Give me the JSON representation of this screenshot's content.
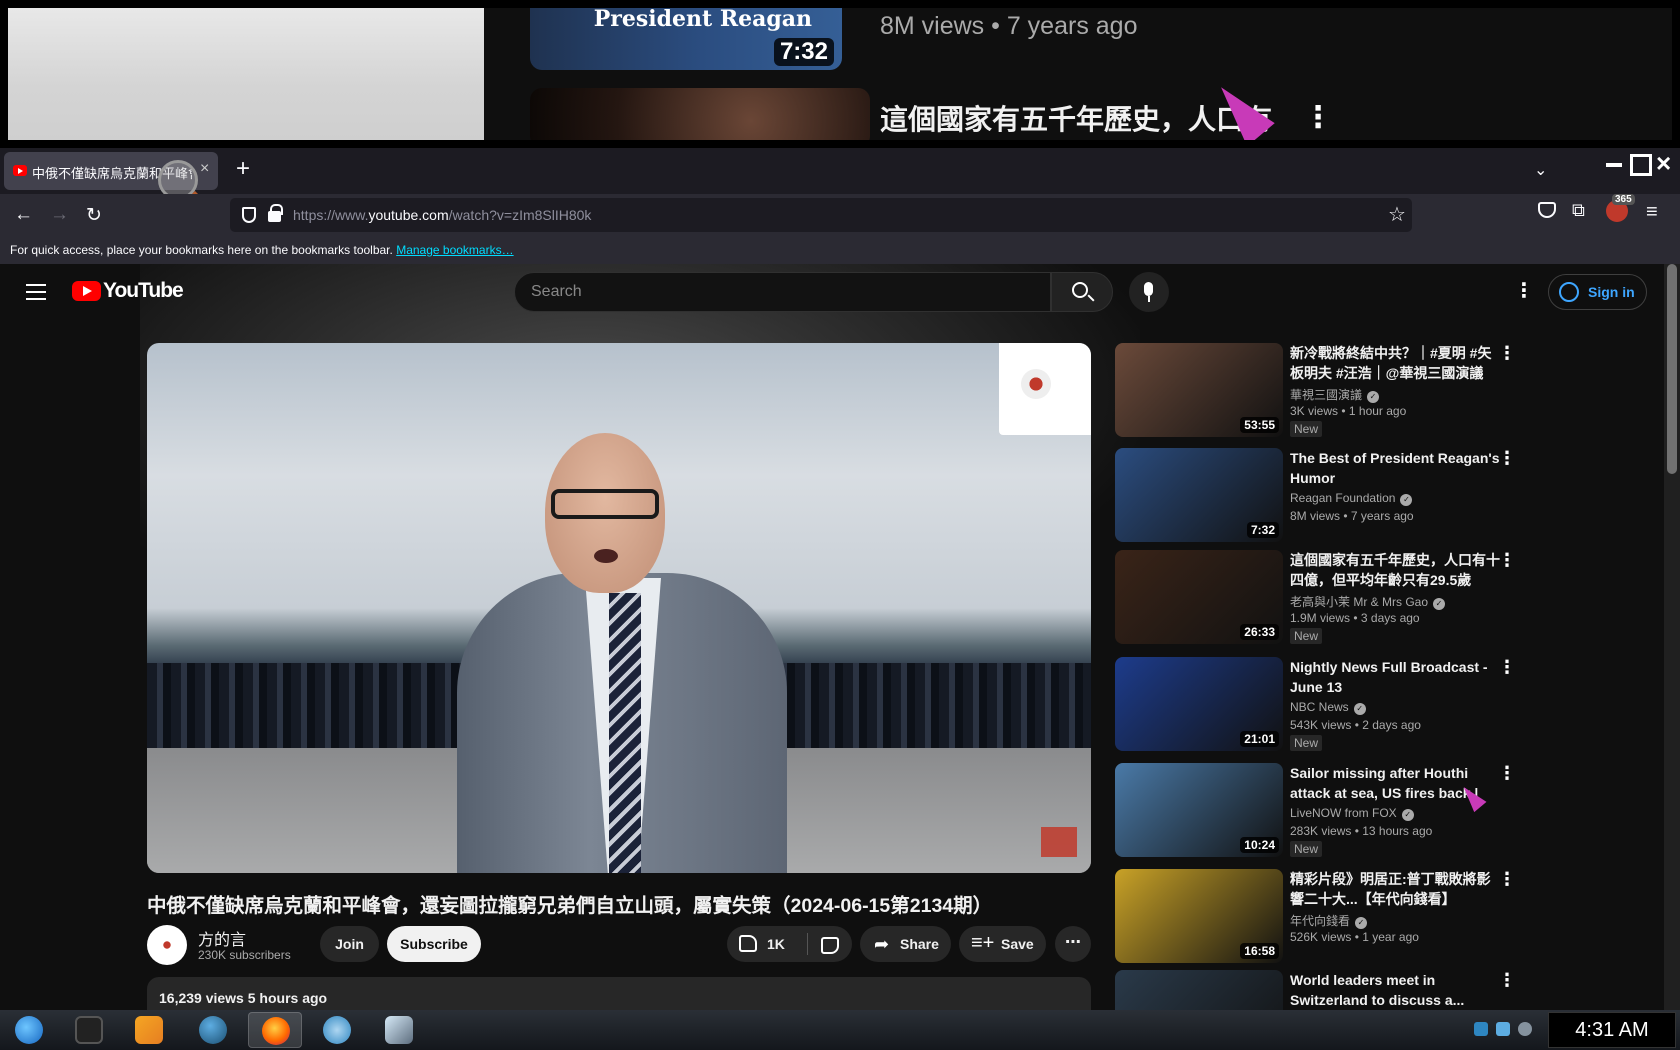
{
  "preview": {
    "thumb_title": "President Reagan",
    "thumb_duration": "7:32",
    "meta": "8M views  • 7 years ago",
    "next_title": "這個國家有五千年歷史，人口有"
  },
  "browser": {
    "tab_title": "中俄不僅缺席烏克蘭和平峰會",
    "url_prefix": "https://www.",
    "url_domain": "youtube.com",
    "url_path": "/watch?v=zIm8SlIH80k",
    "bookmarks_hint": "For quick access, place your bookmarks here on the bookmarks toolbar.",
    "bookmarks_link": "Manage bookmarks…",
    "ext_badge": "365",
    "icons": {
      "back": "←",
      "forward": "→",
      "reload": "↻",
      "star": "☆",
      "new_tab": "+",
      "close": "×",
      "list": "⌄",
      "menu": "≡",
      "extensions": "⧉"
    }
  },
  "youtube": {
    "logo_text": "YouTube",
    "search_placeholder": "Search",
    "signin": "Sign in",
    "video": {
      "title": "中俄不僅缺席烏克蘭和平峰會，還妄圖拉攏窮兄弟們自立山頭，屬實失策（2024-06-15第2134期）",
      "channel": "方的言",
      "subscribers": "230K subscribers",
      "join": "Join",
      "subscribe": "Subscribe",
      "likes": "1K",
      "share": "Share",
      "save": "Save",
      "more": "⋯",
      "desc_meta": "16,239 views  5 hours ago"
    },
    "recommendations": [
      {
        "title": "新冷戰將終結中共？｜#夏明 #矢板明夫 #汪浩｜@華視三國演議",
        "channel": "華視三國演議",
        "views": "3K views  • 1 hour ago",
        "badge": "New",
        "duration": "53:55",
        "thumb_color": "#6b4a3a"
      },
      {
        "title": "The Best of President Reagan's Humor",
        "channel": "Reagan Foundation",
        "views": "8M views  • 7 years ago",
        "badge": "",
        "duration": "7:32",
        "thumb_color": "#2b4d80"
      },
      {
        "title": "這個國家有五千年歷史，人口有十四億，但平均年齡只有29.5歲",
        "channel": "老高與小茉 Mr & Mrs Gao",
        "views": "1.9M views  • 3 days ago",
        "badge": "New",
        "duration": "26:33",
        "thumb_color": "#3a2418"
      },
      {
        "title": "Nightly News Full Broadcast - June 13",
        "channel": "NBC News",
        "views": "543K views  • 2 days ago",
        "badge": "New",
        "duration": "21:01",
        "thumb_color": "#1d3c8c"
      },
      {
        "title": "Sailor missing after Houthi attack at sea, US fires back | LiveNOW from FOX",
        "channel": "LiveNOW from FOX",
        "views": "283K views  • 13 hours ago",
        "badge": "New",
        "duration": "10:24",
        "thumb_color": "#4a7aa8"
      },
      {
        "title": "精彩片段》明居正:普丁戰敗將影響二十大...【年代向錢看】",
        "channel": "年代向錢看",
        "views": "526K views  • 1 year ago",
        "badge": "",
        "duration": "16:58",
        "thumb_color": "#c9a227"
      },
      {
        "title": "World leaders meet in Switzerland to discuss a...",
        "channel": "",
        "views": "",
        "badge": "",
        "duration": "",
        "thumb_color": "#2a3a4a"
      }
    ]
  },
  "taskbar": {
    "clock": "4:31 AM"
  }
}
